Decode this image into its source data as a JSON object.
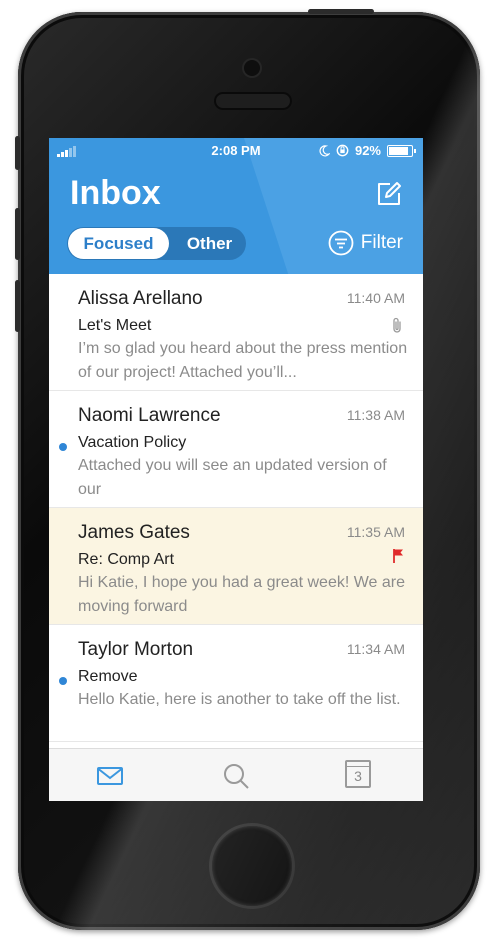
{
  "status_bar": {
    "time": "2:08 PM",
    "battery": "92%"
  },
  "header": {
    "title": "Inbox",
    "tabs": [
      "Focused",
      "Other"
    ],
    "filter_label": "Filter"
  },
  "messages": [
    {
      "sender": "Alissa Arellano",
      "time": "11:40 AM",
      "subject": "Let's Meet",
      "preview": "I’m so glad you heard about the press mention of our project! Attached you’ll...",
      "unread": false,
      "attachment": true,
      "flagged": false
    },
    {
      "sender": "Naomi Lawrence",
      "time": "11:38 AM",
      "subject": "Vacation Policy",
      "preview": "Attached you will see an updated version of our",
      "unread": true,
      "attachment": false,
      "flagged": false
    },
    {
      "sender": "James Gates",
      "time": "11:35 AM",
      "subject": "Re: Comp Art",
      "preview": "Hi Katie, I hope you had a great week! We are moving forward",
      "unread": false,
      "attachment": false,
      "flagged": true
    },
    {
      "sender": "Taylor Morton",
      "time": "11:34 AM",
      "subject": "Remove",
      "preview": "Hello Katie, here is another to take off the list.",
      "unread": true,
      "attachment": false,
      "flagged": false
    }
  ],
  "tab_bar": {
    "calendar_day": "3"
  },
  "colors": {
    "header_blue": "#3b97df",
    "unread_dot": "#2f86d6",
    "flag_red": "#e02b2b",
    "flagged_row_bg": "#fbf5e2"
  }
}
